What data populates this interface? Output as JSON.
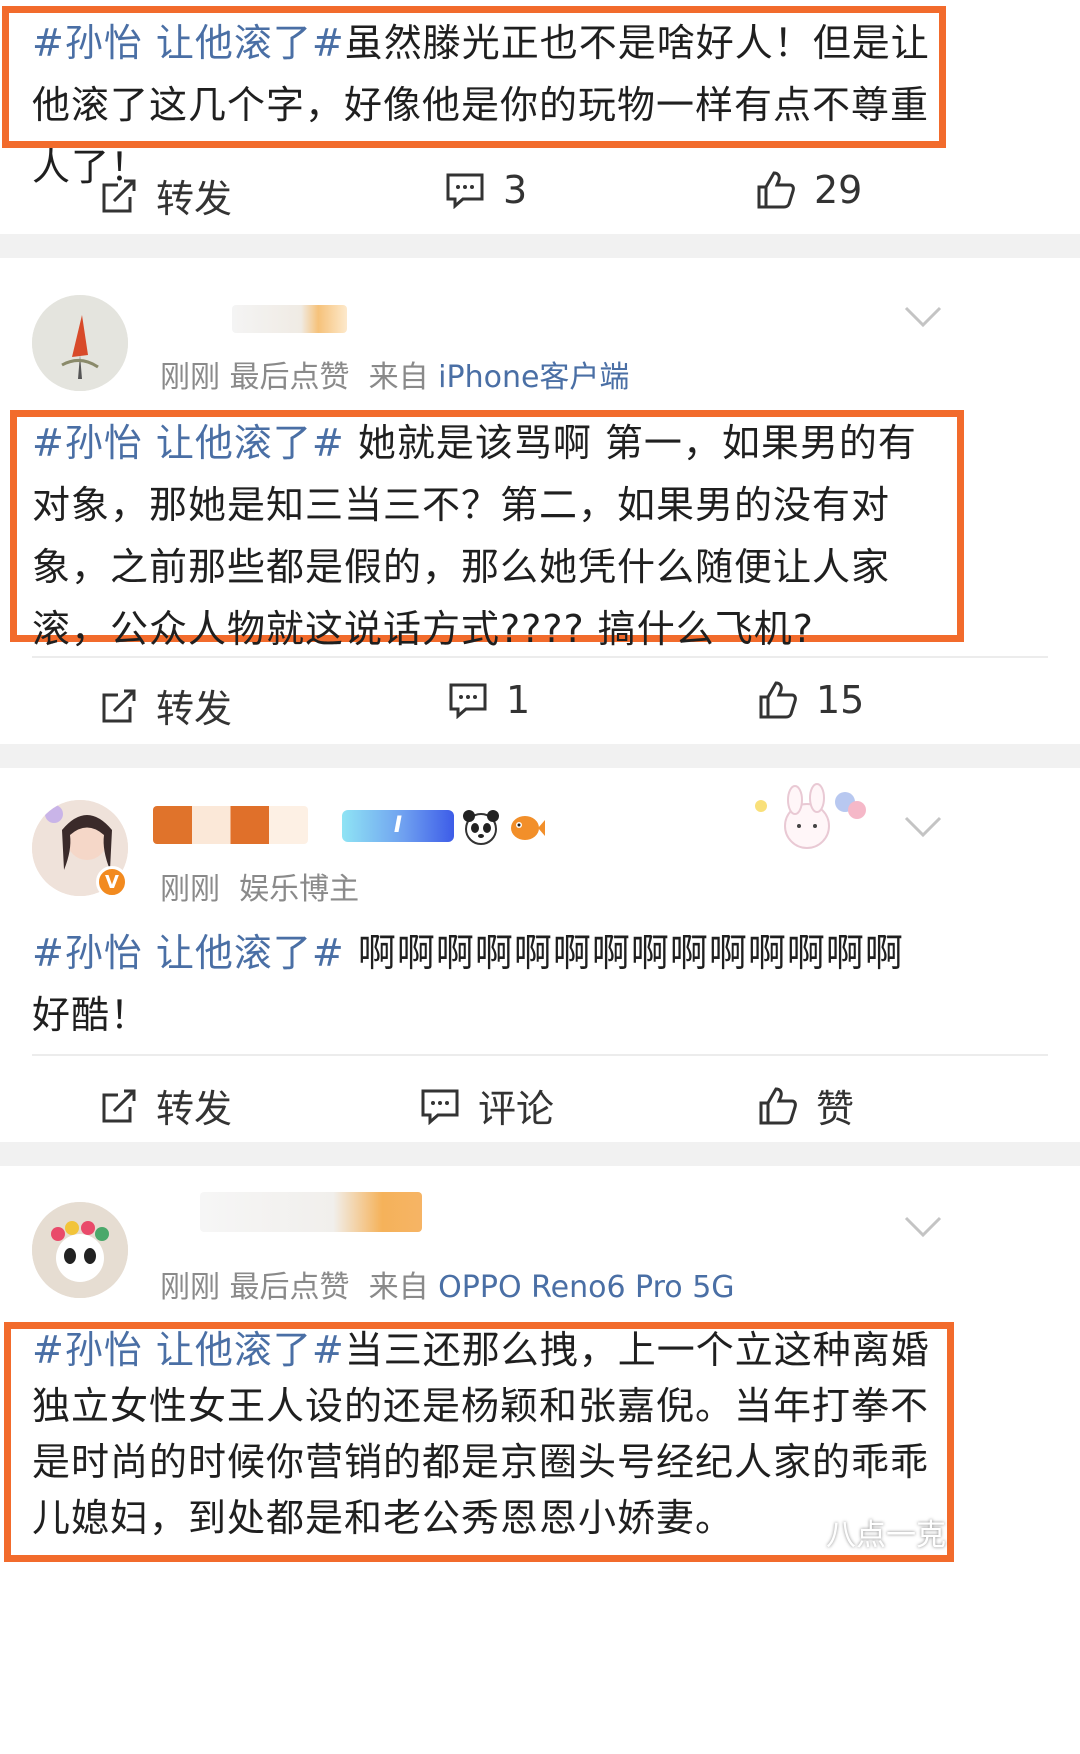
{
  "posts": [
    {
      "hashtag": "#孙怡 让他滚了#",
      "body": "虽然滕光正也不是啥好人！但是让他滚了这几个字，好像他是你的玩物一样有点不尊重人了！",
      "actions": {
        "repost": "转发",
        "comment": "3",
        "like": "29"
      }
    },
    {
      "meta_time": "刚刚",
      "meta_extra": "最后点赞",
      "meta_from": "来自",
      "meta_source": "iPhone客户端",
      "hashtag": "#孙怡 让他滚了#",
      "body": " 她就是该骂啊 第一，如果男的有对象，那她是知三当三不？第二，如果男的没有对象，之前那些都是假的，那么她凭什么随便让人家滚，公众人物就这说话方式???? 搞什么飞机?",
      "actions": {
        "repost": "转发",
        "comment": "1",
        "like": "15"
      }
    },
    {
      "meta_time": "刚刚",
      "meta_extra": "娱乐博主",
      "badge_text": "I",
      "verified_text": "V",
      "hashtag": "#孙怡 让他滚了#",
      "body": " 啊啊啊啊啊啊啊啊啊啊啊啊啊啊好酷！",
      "actions": {
        "repost": "转发",
        "comment": "评论",
        "like": "赞"
      }
    },
    {
      "meta_time": "刚刚",
      "meta_extra": "最后点赞",
      "meta_from": "来自",
      "meta_source": "OPPO Reno6 Pro 5G",
      "hashtag": "#孙怡 让他滚了#",
      "body": "当三还那么拽，上一个立这种离婚独立女性女王人设的还是杨颖和张嘉倪。当年打拳不是时尚的时候你营销的都是京圈头号经纪人家的乖乖儿媳妇，到处都是和老公秀恩恩小娇妻。"
    }
  ],
  "watermark": "八点一克",
  "colors": {
    "highlight": "#f26b2c",
    "link": "#4a6fa5",
    "meta": "#8a8a8a"
  }
}
